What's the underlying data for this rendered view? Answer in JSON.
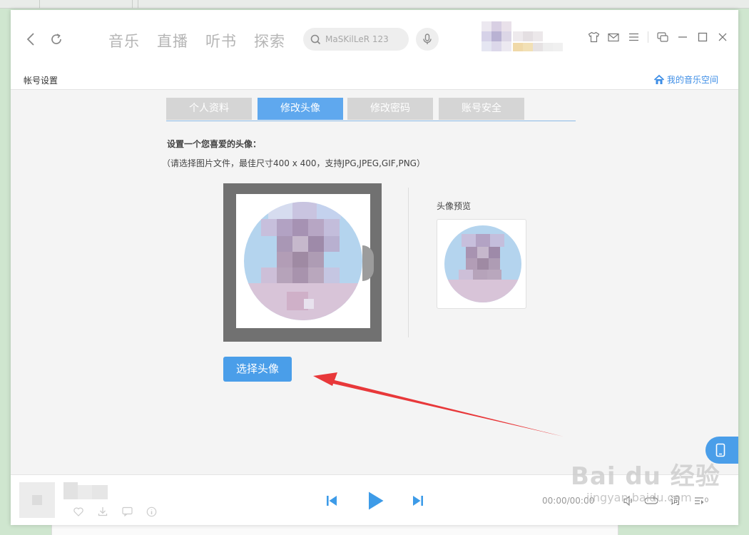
{
  "topbar": {
    "nav_tabs": [
      "音乐",
      "直播",
      "听书",
      "探索"
    ],
    "search_placeholder": "MaSKilLeR 123"
  },
  "subbar": {
    "title": "帐号设置",
    "home_link": "我的音乐空间"
  },
  "tabs": [
    {
      "label": "个人资料",
      "active": false
    },
    {
      "label": "修改头像",
      "active": true
    },
    {
      "label": "修改密码",
      "active": false
    },
    {
      "label": "账号安全",
      "active": false
    }
  ],
  "avatar": {
    "prompt": "设置一个您喜爱的头像：",
    "requirements": "（请选择图片文件，最佳尺寸400 x 400，支持JPG,JPEG,GIF,PNG）",
    "preview_label": "头像预览",
    "choose_button": "选择头像"
  },
  "player": {
    "time": "00:00/00:00",
    "lyric_label": "词",
    "queue_count": "0"
  },
  "watermark": {
    "brand": "Bai du 经验",
    "url": "jingyan.baidu.com"
  },
  "colors": {
    "accent": "#4a9ee9",
    "tab_inactive": "#d5d5d5",
    "annotation_arrow": "#e8383a"
  }
}
